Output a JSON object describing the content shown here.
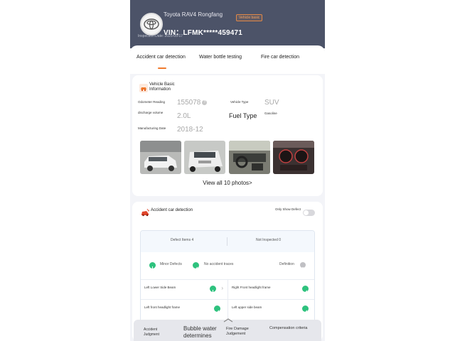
{
  "header": {
    "car_name": "Toyota RAV4 Rongfang",
    "badge": "Vehicle basic",
    "vin": "VIN：LFMK*****459471",
    "inspection_date": "Inspection Date: 2025-05-17"
  },
  "tabs": [
    {
      "label": "Accident car detection",
      "active": true
    },
    {
      "label": "Water bottle testing",
      "active": false
    },
    {
      "label": "Fire car detection",
      "active": false
    }
  ],
  "basic_info": {
    "title": "Vehicle Basic Information",
    "odometer_label": "Odometer Reading",
    "odometer_value": "155078",
    "vehicle_type_label": "Vehicle Type",
    "vehicle_type_value": "SUV",
    "displacement_label": "discharge volume",
    "displacement_value": "2.0L",
    "fuel_type_label": "Fuel Type",
    "fuel_type_value": "Gasoline",
    "manufacturing_label": "Manufacturing Date",
    "manufacturing_value": "2018-12",
    "view_all": "View all 10 photos>"
  },
  "accident": {
    "title": "Accident car detection",
    "toggle_label": "Only Show Defect",
    "defect_items": "Defect Items 4",
    "not_inspected": "Not Inspected 0",
    "minor_defects": "Minor Defects",
    "no_accident": "No accident traces",
    "definition": "Definition",
    "items": [
      {
        "name": "Left Lower Side Beam",
        "status": "minor"
      },
      {
        "name": "Right Front headlight frame",
        "status": "ok"
      },
      {
        "name": "Left front headlight frame",
        "status": "ok"
      },
      {
        "name": "Left upper side beam",
        "status": "ok"
      }
    ]
  },
  "bottom_nav": [
    {
      "label": "Accident Judgment"
    },
    {
      "label": "Bubble water determines"
    },
    {
      "label": "Fire Damage Judgement"
    },
    {
      "label": "Compensation criteria"
    }
  ],
  "colors": {
    "header_bg": "#4c5368",
    "accent": "#f07a2c",
    "ok_green": "#2ec27e",
    "minor_orange": "#f0a048"
  }
}
